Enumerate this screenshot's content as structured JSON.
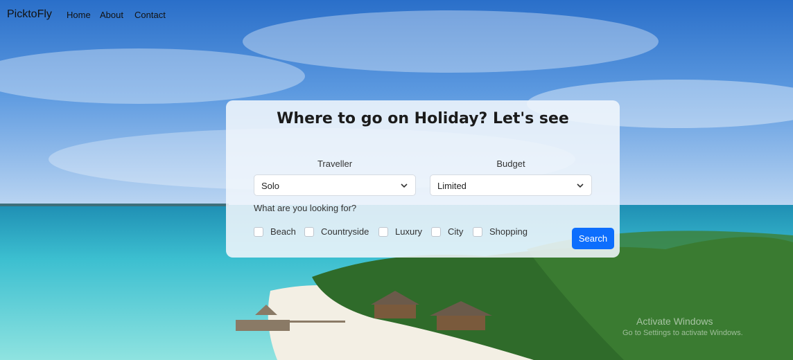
{
  "navbar": {
    "brand": "PicktoFly",
    "links": [
      "Home",
      "About",
      "Contact"
    ]
  },
  "card": {
    "title": "Where to go on Holiday? Let's see",
    "traveller": {
      "label": "Traveller",
      "value": "Solo"
    },
    "budget": {
      "label": "Budget",
      "value": "Limited"
    },
    "question": "What are you looking for?",
    "options": [
      "Beach",
      "Countryside",
      "Luxury",
      "City",
      "Shopping"
    ],
    "search_label": "Search"
  },
  "watermark": {
    "line1": "Activate Windows",
    "line2": "Go to Settings to activate Windows."
  },
  "colors": {
    "accent": "#0d6efd",
    "sky": "#2f7fd6",
    "sea": "#48c9cf",
    "sand": "#f3efe4",
    "foliage": "#2f6b2a"
  },
  "icons": [
    "chevron-down-icon"
  ]
}
